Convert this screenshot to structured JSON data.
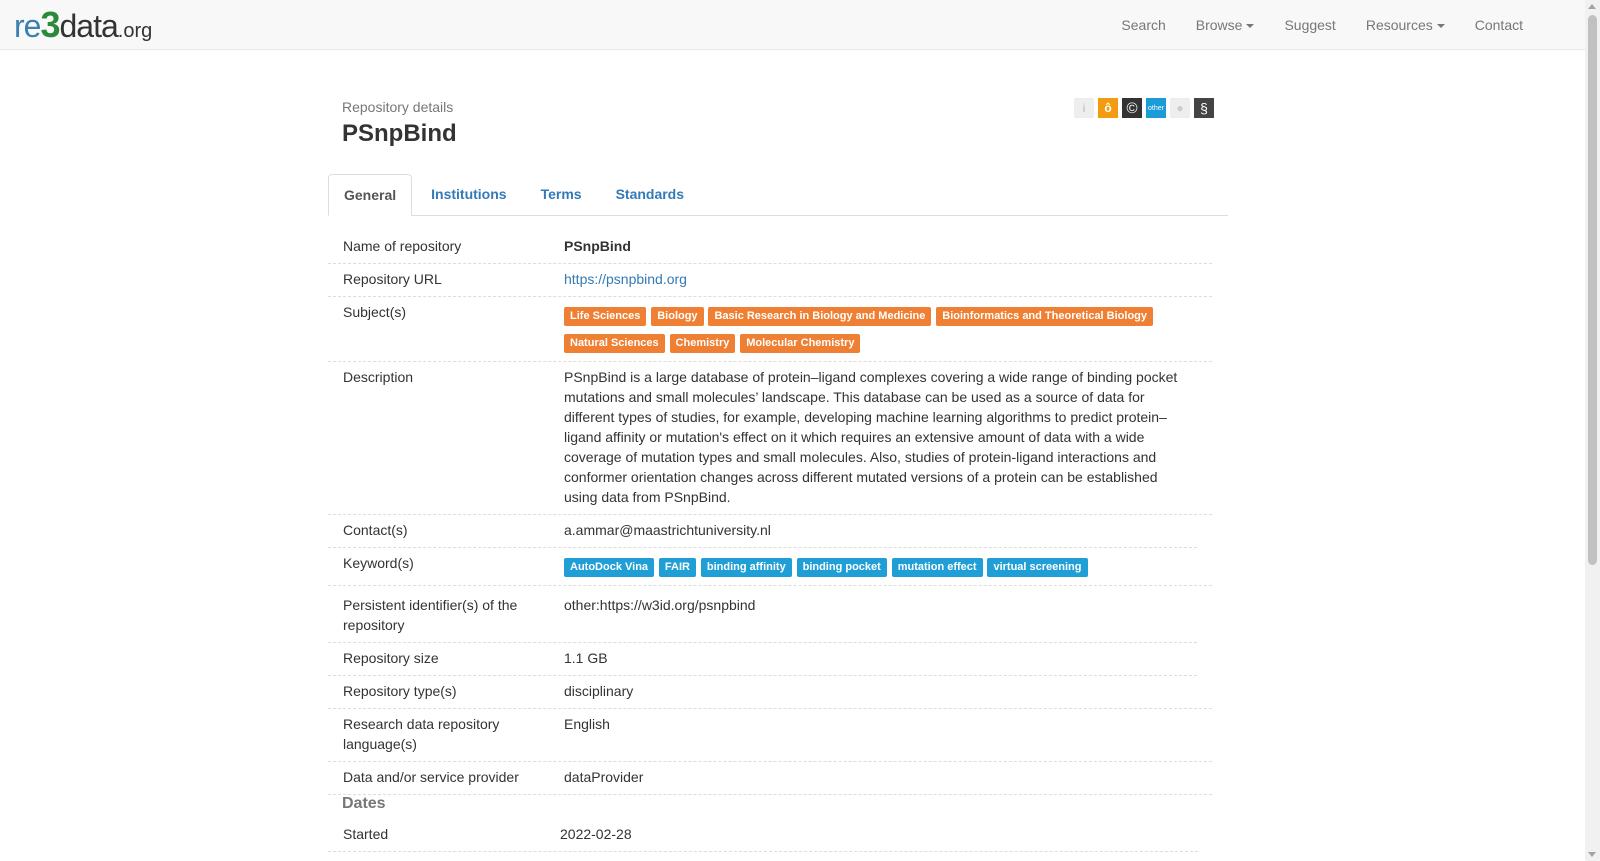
{
  "nav": {
    "logo": {
      "re": "re",
      "three": "3",
      "data": "data",
      "org": ".org"
    },
    "items": [
      {
        "label": "Search",
        "dropdown": false
      },
      {
        "label": "Browse",
        "dropdown": true
      },
      {
        "label": "Suggest",
        "dropdown": false
      },
      {
        "label": "Resources",
        "dropdown": true
      },
      {
        "label": "Contact",
        "dropdown": false
      }
    ]
  },
  "header": {
    "subtitle": "Repository details",
    "title": "PSnpBind",
    "badges": [
      {
        "name": "info-icon",
        "glyph": "i",
        "bg": "#eeeeee",
        "fg": "#bbbbbb"
      },
      {
        "name": "open-access-icon",
        "glyph": "ô",
        "bg": "#f39c12",
        "fg": "#ffffff"
      },
      {
        "name": "copyright-icon",
        "glyph": "©",
        "bg": "#333333",
        "fg": "#ffffff"
      },
      {
        "name": "other-license-icon",
        "glyph": "other",
        "bg": "#1b9bd7",
        "fg": "#ffffff"
      },
      {
        "name": "certificate-icon",
        "glyph": "●",
        "bg": "#eeeeee",
        "fg": "#cccccc"
      },
      {
        "name": "policy-icon",
        "glyph": "§",
        "bg": "#444444",
        "fg": "#ffffff"
      }
    ]
  },
  "tabs": [
    {
      "label": "General",
      "active": true
    },
    {
      "label": "Institutions",
      "active": false
    },
    {
      "label": "Terms",
      "active": false
    },
    {
      "label": "Standards",
      "active": false
    }
  ],
  "general": {
    "name_label": "Name of repository",
    "name_value": "PSnpBind",
    "url_label": "Repository URL",
    "url_value": "https://psnpbind.org",
    "subjects_label": "Subject(s)",
    "subjects": [
      "Life Sciences",
      "Biology",
      "Basic Research in Biology and Medicine",
      "Bioinformatics and Theoretical Biology",
      "Natural Sciences",
      "Chemistry",
      "Molecular Chemistry"
    ],
    "description_label": "Description",
    "description_value": "PSnpBind is a large database of protein–ligand complexes covering a wide range of binding pocket mutations and small molecules’ landscape. This database can be used as a source of data for different types of studies, for example, developing machine learning algorithms to predict protein–ligand affinity or mutation's effect on it which requires an extensive amount of data with a wide coverage of mutation types and small molecules. Also, studies of protein-ligand interactions and conformer orientation changes across different mutated versions of a protein can be established using data from PSnpBind.",
    "contact_label": "Contact(s)",
    "contact_value": "a.ammar@maastrichtuniversity.nl",
    "keywords_label": "Keyword(s)",
    "keywords": [
      "AutoDock Vina",
      "FAIR",
      "binding affinity",
      "binding pocket",
      "mutation effect",
      "virtual screening"
    ],
    "pid_label": "Persistent identifier(s) of the repository",
    "pid_value": "other:https://w3id.org/psnpbind",
    "size_label": "Repository size",
    "size_value": "1.1 GB",
    "type_label": "Repository type(s)",
    "type_value": "disciplinary",
    "language_label": "Research data repository language(s)",
    "language_value": "English",
    "provider_label": "Data and/or service provider",
    "provider_value": "dataProvider"
  },
  "dates": {
    "heading": "Dates",
    "started_label": "Started",
    "started_value": "2022-02-28"
  }
}
